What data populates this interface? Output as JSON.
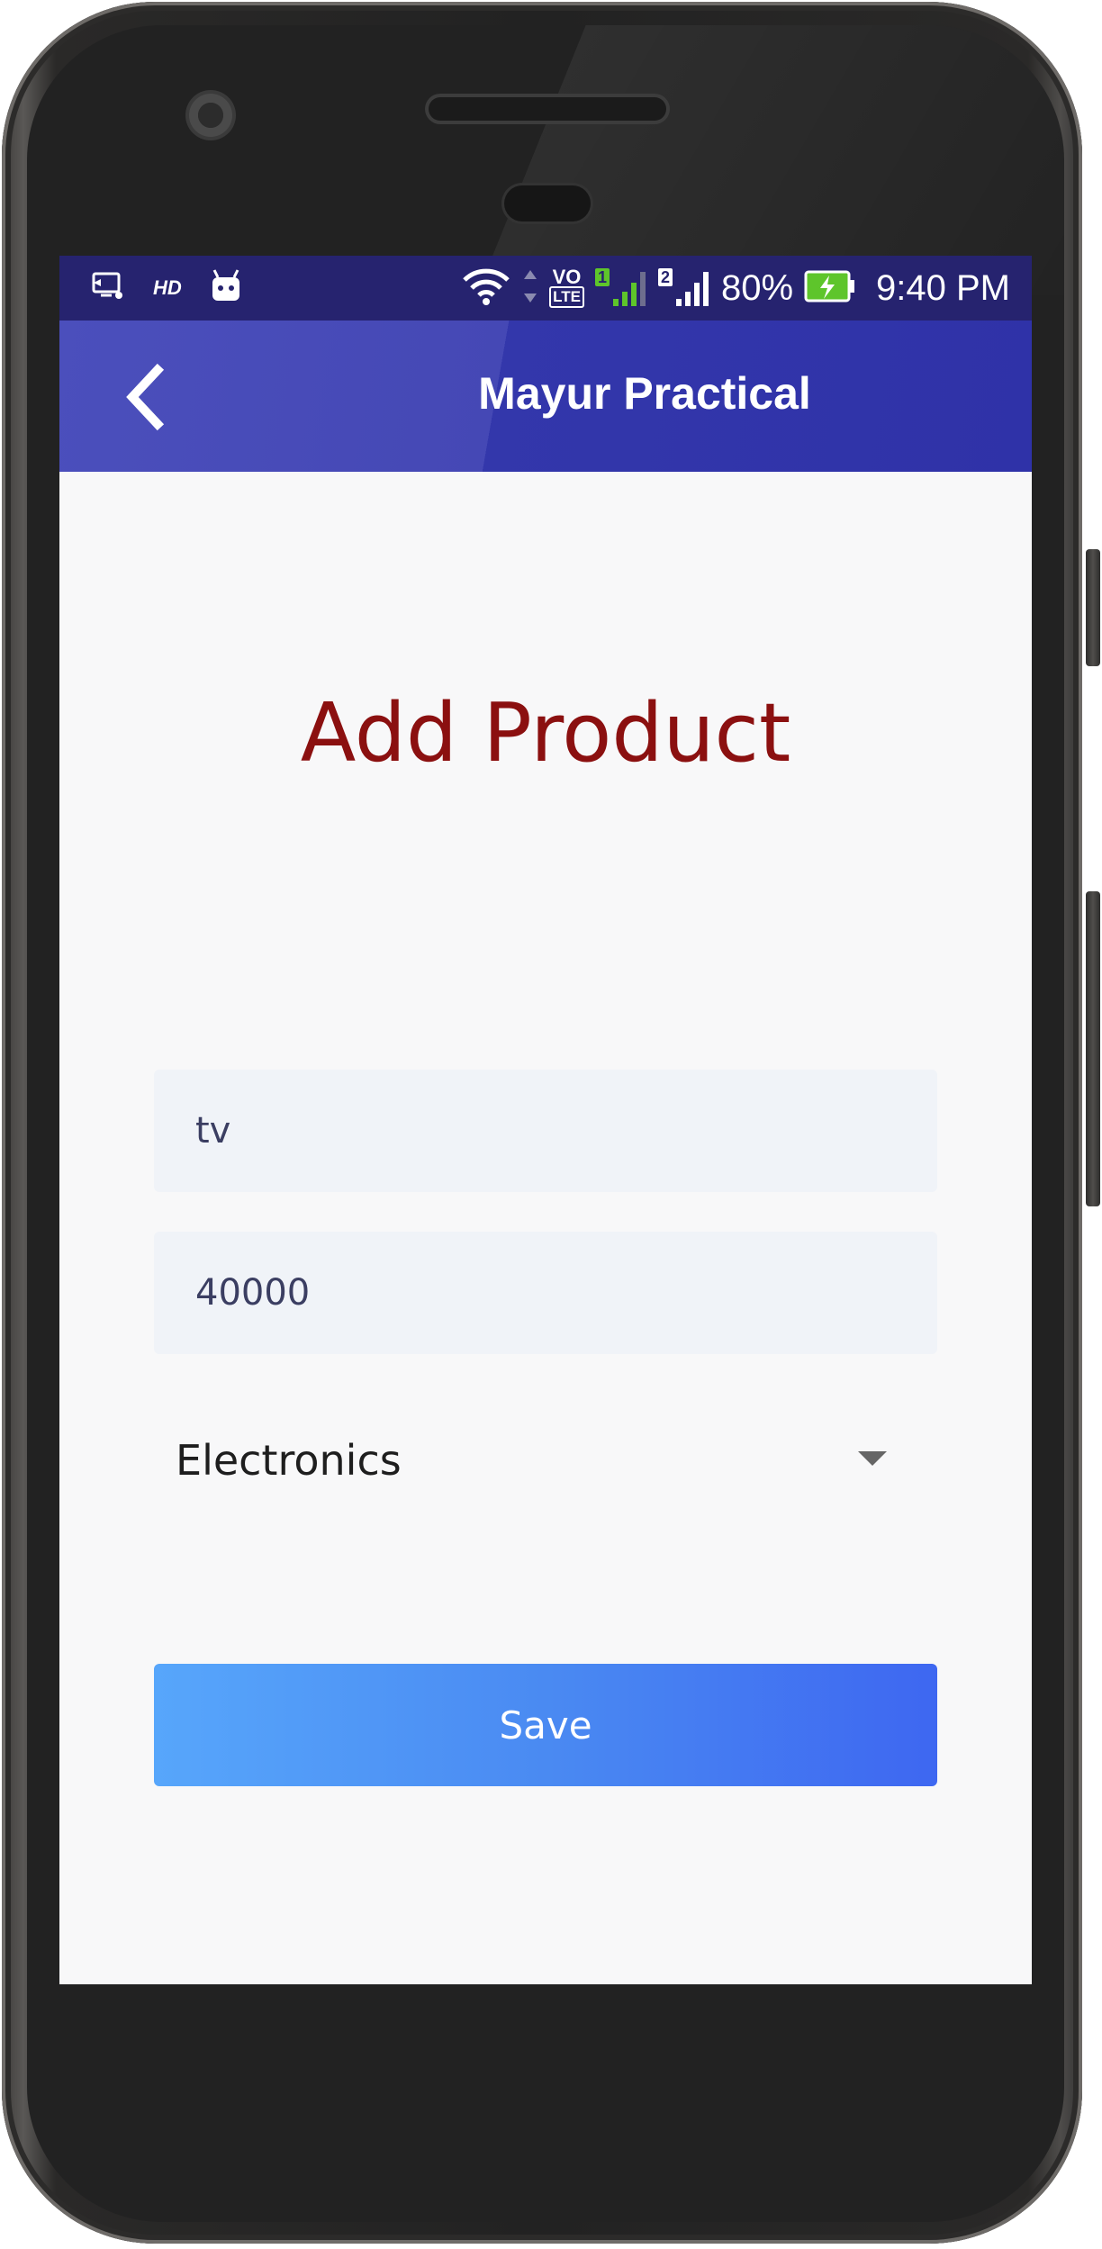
{
  "statusbar": {
    "hd_label": "HD",
    "volte_top": "VO",
    "volte_bottom": "LTE",
    "sim1": "1",
    "sim2": "2",
    "battery_percent": "80%",
    "time": "9:40 PM",
    "sim1_color": "#5ec52b"
  },
  "toolbar": {
    "title": "Mayur Practical",
    "back_icon": "chevron-left-icon",
    "colors": {
      "left": "#4b4fbc",
      "right": "#2f32a8"
    }
  },
  "form": {
    "heading": "Add Product",
    "name_value": "tv",
    "price_value": "40000",
    "category_selected": "Electronics",
    "save_label": "Save"
  },
  "colors": {
    "heading": "#8b1010",
    "statusbar_bg": "#26236f",
    "save_gradient": [
      "#57a6fb",
      "#3e67f1"
    ]
  }
}
